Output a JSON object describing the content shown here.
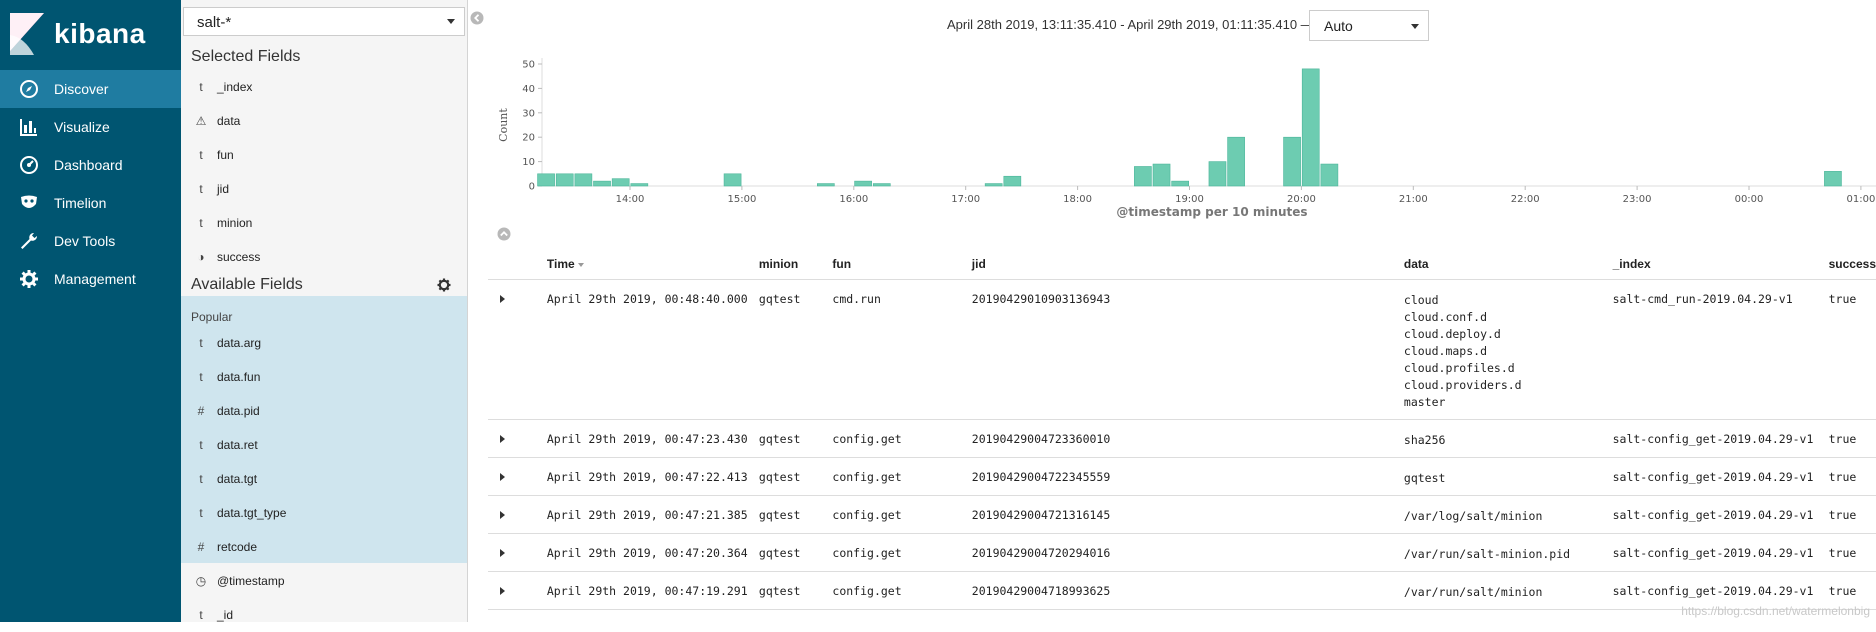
{
  "app": {
    "name": "kibana"
  },
  "nav": [
    {
      "id": "discover",
      "label": "Discover",
      "icon": "compass-icon",
      "active": true
    },
    {
      "id": "visualize",
      "label": "Visualize",
      "icon": "bar-chart-icon",
      "active": false
    },
    {
      "id": "dashboard",
      "label": "Dashboard",
      "icon": "dashboard-gauge-icon",
      "active": false
    },
    {
      "id": "timelion",
      "label": "Timelion",
      "icon": "timelion-mask-icon",
      "active": false
    },
    {
      "id": "devtools",
      "label": "Dev Tools",
      "icon": "wrench-icon",
      "active": false
    },
    {
      "id": "management",
      "label": "Management",
      "icon": "gear-icon",
      "active": false
    }
  ],
  "index_pattern": "salt-*",
  "selected_fields": {
    "title": "Selected Fields",
    "items": [
      {
        "type": "t",
        "name": "_index"
      },
      {
        "type": "⚠",
        "name": "data"
      },
      {
        "type": "t",
        "name": "fun"
      },
      {
        "type": "t",
        "name": "jid"
      },
      {
        "type": "t",
        "name": "minion"
      },
      {
        "type": "◑",
        "name": "success"
      }
    ]
  },
  "available_fields": {
    "title": "Available Fields",
    "popular_label": "Popular",
    "items": [
      {
        "type": "t",
        "name": "data.arg"
      },
      {
        "type": "t",
        "name": "data.fun"
      },
      {
        "type": "#",
        "name": "data.pid"
      },
      {
        "type": "t",
        "name": "data.ret"
      },
      {
        "type": "t",
        "name": "data.tgt"
      },
      {
        "type": "t",
        "name": "data.tgt_type"
      },
      {
        "type": "#",
        "name": "retcode"
      },
      {
        "type": "◷",
        "name": "@timestamp"
      },
      {
        "type": "t",
        "name": "_id"
      }
    ]
  },
  "time_range": "April 28th 2019, 13:11:35.410 - April 29th 2019, 01:11:35.410 —",
  "interval": "Auto",
  "chart_data": {
    "type": "bar",
    "ylabel": "Count",
    "xlabel": "@timestamp per 10 minutes",
    "ylim": [
      0,
      50
    ],
    "y_ticks": [
      0,
      10,
      20,
      30,
      40,
      50
    ],
    "x_ticks": [
      "14:00",
      "15:00",
      "16:00",
      "17:00",
      "18:00",
      "19:00",
      "20:00",
      "21:00",
      "22:00",
      "23:00",
      "00:00",
      "01:00"
    ],
    "color": "#6dccb1",
    "bars": [
      {
        "t": "13:20",
        "v": 5
      },
      {
        "t": "13:30",
        "v": 5
      },
      {
        "t": "13:40",
        "v": 5
      },
      {
        "t": "13:50",
        "v": 2
      },
      {
        "t": "14:00",
        "v": 3
      },
      {
        "t": "14:10",
        "v": 1
      },
      {
        "t": "15:00",
        "v": 5
      },
      {
        "t": "15:50",
        "v": 1
      },
      {
        "t": "16:10",
        "v": 2
      },
      {
        "t": "16:20",
        "v": 1
      },
      {
        "t": "17:20",
        "v": 1
      },
      {
        "t": "17:30",
        "v": 4
      },
      {
        "t": "18:40",
        "v": 8
      },
      {
        "t": "18:50",
        "v": 9
      },
      {
        "t": "19:00",
        "v": 2
      },
      {
        "t": "19:20",
        "v": 10
      },
      {
        "t": "19:30",
        "v": 20
      },
      {
        "t": "20:00",
        "v": 20
      },
      {
        "t": "20:10",
        "v": 48
      },
      {
        "t": "20:20",
        "v": 9
      },
      {
        "t": "00:50",
        "v": 6
      }
    ]
  },
  "table": {
    "columns": [
      "Time",
      "minion",
      "fun",
      "jid",
      "data",
      "_index",
      "success"
    ],
    "rows": [
      {
        "time": "April 29th 2019, 00:48:40.000",
        "minion": "gqtest",
        "fun": "cmd.run",
        "jid": "20190429010903136943",
        "data": [
          "cloud",
          "cloud.conf.d",
          "cloud.deploy.d",
          "cloud.maps.d",
          "cloud.profiles.d",
          "cloud.providers.d",
          "master"
        ],
        "index": "salt-cmd_run-2019.04.29-v1",
        "success": "true"
      },
      {
        "time": "April 29th 2019, 00:47:23.430",
        "minion": "gqtest",
        "fun": "config.get",
        "jid": "20190429004723360010",
        "data": [
          "sha256"
        ],
        "index": "salt-config_get-2019.04.29-v1",
        "success": "true"
      },
      {
        "time": "April 29th 2019, 00:47:22.413",
        "minion": "gqtest",
        "fun": "config.get",
        "jid": "20190429004722345559",
        "data": [
          "gqtest"
        ],
        "index": "salt-config_get-2019.04.29-v1",
        "success": "true"
      },
      {
        "time": "April 29th 2019, 00:47:21.385",
        "minion": "gqtest",
        "fun": "config.get",
        "jid": "20190429004721316145",
        "data": [
          "/var/log/salt/minion"
        ],
        "index": "salt-config_get-2019.04.29-v1",
        "success": "true"
      },
      {
        "time": "April 29th 2019, 00:47:20.364",
        "minion": "gqtest",
        "fun": "config.get",
        "jid": "20190429004720294016",
        "data": [
          "/var/run/salt-minion.pid"
        ],
        "index": "salt-config_get-2019.04.29-v1",
        "success": "true"
      },
      {
        "time": "April 29th 2019, 00:47:19.291",
        "minion": "gqtest",
        "fun": "config.get",
        "jid": "20190429004718993625",
        "data": [
          "/var/run/salt/minion"
        ],
        "index": "salt-config_get-2019.04.29-v1",
        "success": "true"
      }
    ]
  },
  "watermark": "https://blog.csdn.net/watermelonbig"
}
